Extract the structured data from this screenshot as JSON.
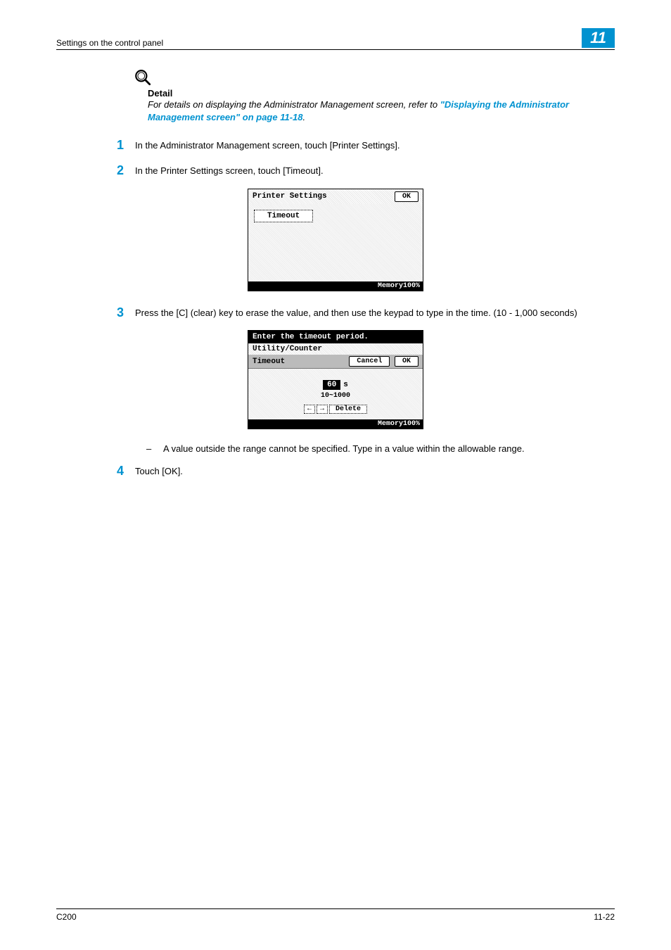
{
  "header": {
    "title": "Settings on the control panel",
    "chapter": "11"
  },
  "detail": {
    "label": "Detail",
    "text_prefix": "For details on displaying the Administrator Management screen, refer to ",
    "link": "\"Displaying the Administrator Management screen\" on page 11-18",
    "text_suffix": "."
  },
  "steps": {
    "s1": {
      "num": "1",
      "text": "In the Administrator Management screen, touch [Printer Settings]."
    },
    "s2": {
      "num": "2",
      "text": "In the Printer Settings screen, touch [Timeout]."
    },
    "s3": {
      "num": "3",
      "text": "Press the [C] (clear) key to erase the value, and then use the keypad to type in the time. (10 - 1,000 seconds)"
    },
    "s4": {
      "num": "4",
      "text": "Touch [OK]."
    }
  },
  "screen1": {
    "title": "Printer Settings",
    "ok": "OK",
    "timeout_btn": "Timeout",
    "memory": "Memory100%"
  },
  "screen2": {
    "instruction": "Enter the timeout period.",
    "breadcrumb": "Utility/Counter",
    "section": "Timeout",
    "cancel": "Cancel",
    "ok": "OK",
    "value": "60",
    "unit": "s",
    "range": "10~1000",
    "left": "←",
    "right": "→",
    "delete": "Delete",
    "memory": "Memory100%"
  },
  "bullet": {
    "dash": "–",
    "text": "A value outside the range cannot be specified. Type in a value within the allowable range."
  },
  "footer": {
    "model": "C200",
    "page": "11-22"
  }
}
